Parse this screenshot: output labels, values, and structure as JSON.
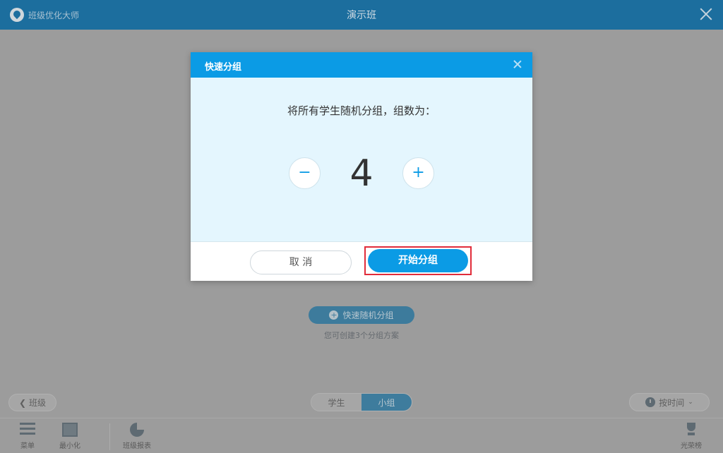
{
  "app": {
    "brand_name": "班级优化大师",
    "window_title": "演示班"
  },
  "background": {
    "quick_group_button": "快速随机分组",
    "hint": "您可创建3个分组方案",
    "back_button": "班级",
    "tabs": [
      {
        "label": "学生",
        "active": false
      },
      {
        "label": "小组",
        "active": true
      }
    ],
    "sort_button": "按时间"
  },
  "toolbar": {
    "menu_label": "菜单",
    "minimize_label": "最小化",
    "report_label": "班级报表",
    "honor_label": "光荣榜"
  },
  "dialog": {
    "title": "快速分组",
    "prompt": "将所有学生随机分组，组数为：",
    "minus_glyph": "−",
    "plus_glyph": "+",
    "group_count": "4",
    "cancel_button": "取 消",
    "start_button": "开始分组"
  },
  "colors": {
    "accent": "#0b9be5",
    "title_bar": "#1c6e9e",
    "highlight_box": "#e12c3a"
  }
}
